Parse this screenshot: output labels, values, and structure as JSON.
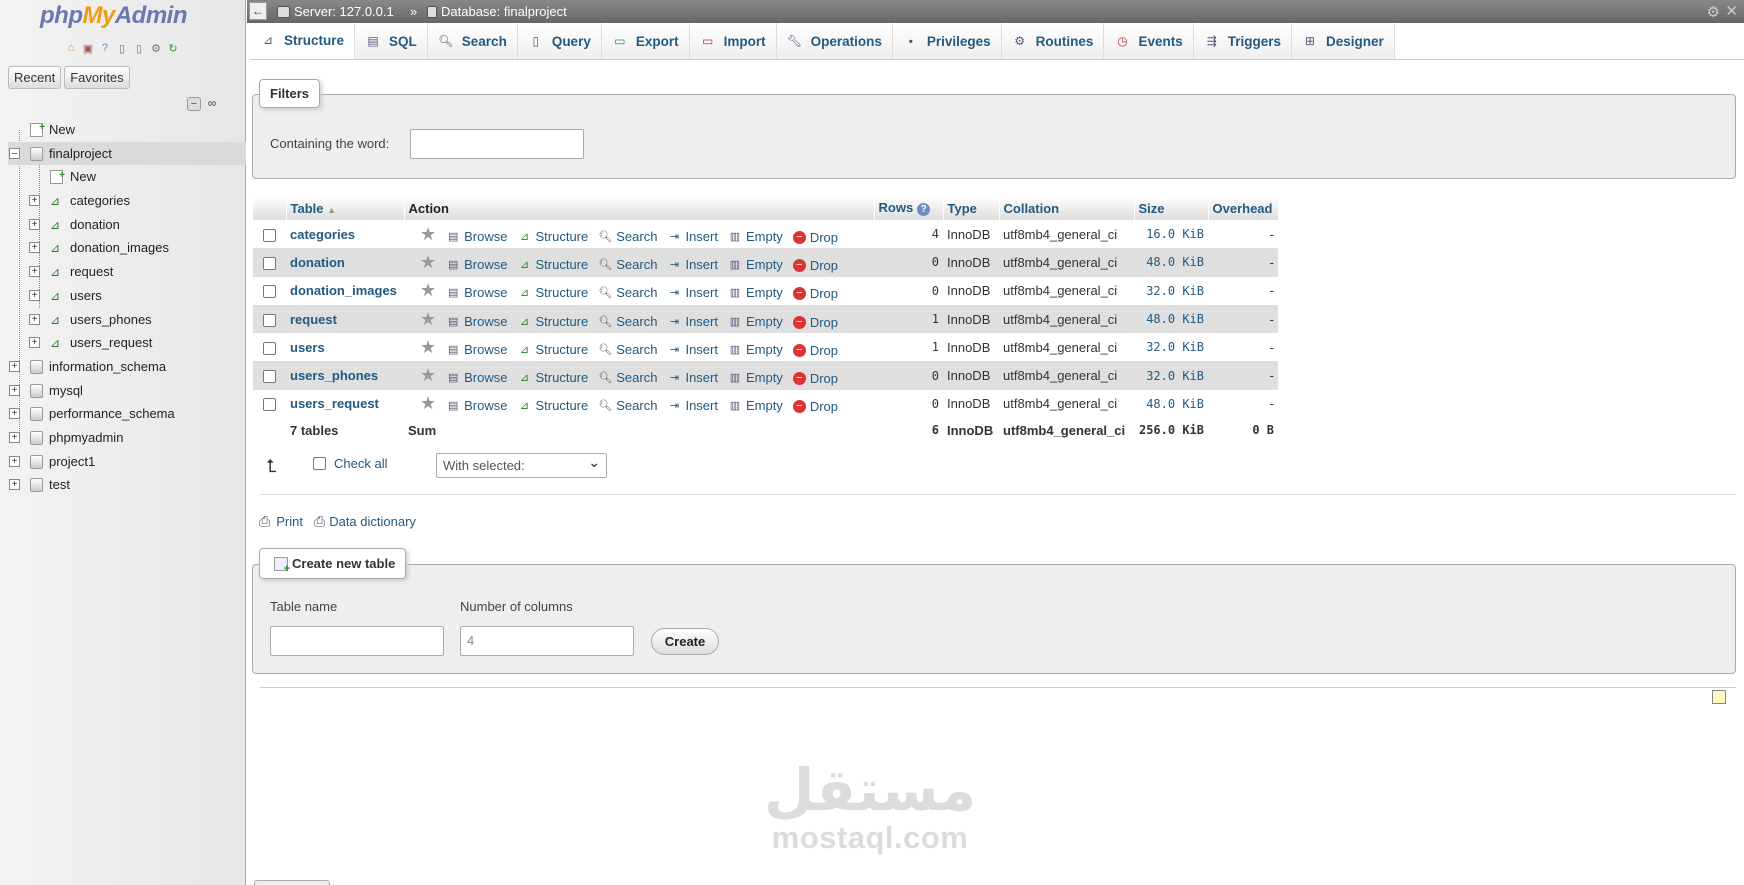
{
  "app": {
    "logo_php": "php",
    "logo_my": "My",
    "logo_admin": "Admin"
  },
  "nav": {
    "recent_label": "Recent",
    "favorites_label": "Favorites",
    "tree": [
      {
        "label": "New",
        "level": 0,
        "kind": "new"
      },
      {
        "label": "finalproject",
        "level": 0,
        "kind": "db",
        "expanded": true
      },
      {
        "label": "New",
        "level": 1,
        "kind": "new"
      },
      {
        "label": "categories",
        "level": 1,
        "kind": "table"
      },
      {
        "label": "donation",
        "level": 1,
        "kind": "table"
      },
      {
        "label": "donation_images",
        "level": 1,
        "kind": "table"
      },
      {
        "label": "request",
        "level": 1,
        "kind": "table"
      },
      {
        "label": "users",
        "level": 1,
        "kind": "table"
      },
      {
        "label": "users_phones",
        "level": 1,
        "kind": "table"
      },
      {
        "label": "users_request",
        "level": 1,
        "kind": "table"
      },
      {
        "label": "information_schema",
        "level": 0,
        "kind": "db"
      },
      {
        "label": "mysql",
        "level": 0,
        "kind": "db"
      },
      {
        "label": "performance_schema",
        "level": 0,
        "kind": "db"
      },
      {
        "label": "phpmyadmin",
        "level": 0,
        "kind": "db"
      },
      {
        "label": "project1",
        "level": 0,
        "kind": "db"
      },
      {
        "label": "test",
        "level": 0,
        "kind": "db"
      }
    ]
  },
  "breadcrumb": {
    "server": "Server: 127.0.0.1",
    "separator": "»",
    "database": "Database: finalproject"
  },
  "tabs": [
    {
      "label": "Structure",
      "icon": "structure-icon",
      "active": true
    },
    {
      "label": "SQL",
      "icon": "sql-icon"
    },
    {
      "label": "Search",
      "icon": "search-icon"
    },
    {
      "label": "Query",
      "icon": "query-icon"
    },
    {
      "label": "Export",
      "icon": "export-icon"
    },
    {
      "label": "Import",
      "icon": "import-icon"
    },
    {
      "label": "Operations",
      "icon": "wrench-icon"
    },
    {
      "label": "Privileges",
      "icon": "privileges-icon"
    },
    {
      "label": "Routines",
      "icon": "routines-icon"
    },
    {
      "label": "Events",
      "icon": "clock-icon"
    },
    {
      "label": "Triggers",
      "icon": "triggers-icon"
    },
    {
      "label": "Designer",
      "icon": "designer-icon"
    }
  ],
  "filters": {
    "legend": "Filters",
    "label": "Containing the word:",
    "value": ""
  },
  "table": {
    "headers": {
      "table": "Table",
      "action": "Action",
      "rows": "Rows",
      "type": "Type",
      "collation": "Collation",
      "size": "Size",
      "overhead": "Overhead"
    },
    "actions": {
      "browse": "Browse",
      "structure": "Structure",
      "search": "Search",
      "insert": "Insert",
      "empty": "Empty",
      "drop": "Drop"
    },
    "rows": [
      {
        "name": "categories",
        "rows": "4",
        "type": "InnoDB",
        "collation": "utf8mb4_general_ci",
        "size": "16.0 KiB",
        "overhead": "-"
      },
      {
        "name": "donation",
        "rows": "0",
        "type": "InnoDB",
        "collation": "utf8mb4_general_ci",
        "size": "48.0 KiB",
        "overhead": "-"
      },
      {
        "name": "donation_images",
        "rows": "0",
        "type": "InnoDB",
        "collation": "utf8mb4_general_ci",
        "size": "32.0 KiB",
        "overhead": "-"
      },
      {
        "name": "request",
        "rows": "1",
        "type": "InnoDB",
        "collation": "utf8mb4_general_ci",
        "size": "48.0 KiB",
        "overhead": "-"
      },
      {
        "name": "users",
        "rows": "1",
        "type": "InnoDB",
        "collation": "utf8mb4_general_ci",
        "size": "32.0 KiB",
        "overhead": "-"
      },
      {
        "name": "users_phones",
        "rows": "0",
        "type": "InnoDB",
        "collation": "utf8mb4_general_ci",
        "size": "32.0 KiB",
        "overhead": "-"
      },
      {
        "name": "users_request",
        "rows": "0",
        "type": "InnoDB",
        "collation": "utf8mb4_general_ci",
        "size": "48.0 KiB",
        "overhead": "-"
      }
    ],
    "summary": {
      "count": "7 tables",
      "sum_label": "Sum",
      "rows": "6",
      "type": "InnoDB",
      "collation": "utf8mb4_general_ci",
      "size": "256.0 KiB",
      "overhead": "0 B"
    }
  },
  "bulk": {
    "check_all": "Check all",
    "with_selected": "With selected:"
  },
  "links": {
    "print": "Print",
    "data_dictionary": "Data dictionary"
  },
  "create_table": {
    "legend": "Create new table",
    "name_label": "Table name",
    "name_value": "",
    "columns_label": "Number of columns",
    "columns_value": "4",
    "create_button": "Create"
  },
  "watermark": {
    "arabic": "مستقل",
    "latin": "mostaql.com"
  },
  "colors": {
    "link": "#235a81",
    "accent_orange": "#f29c13",
    "logo_blue": "#6c78af"
  }
}
